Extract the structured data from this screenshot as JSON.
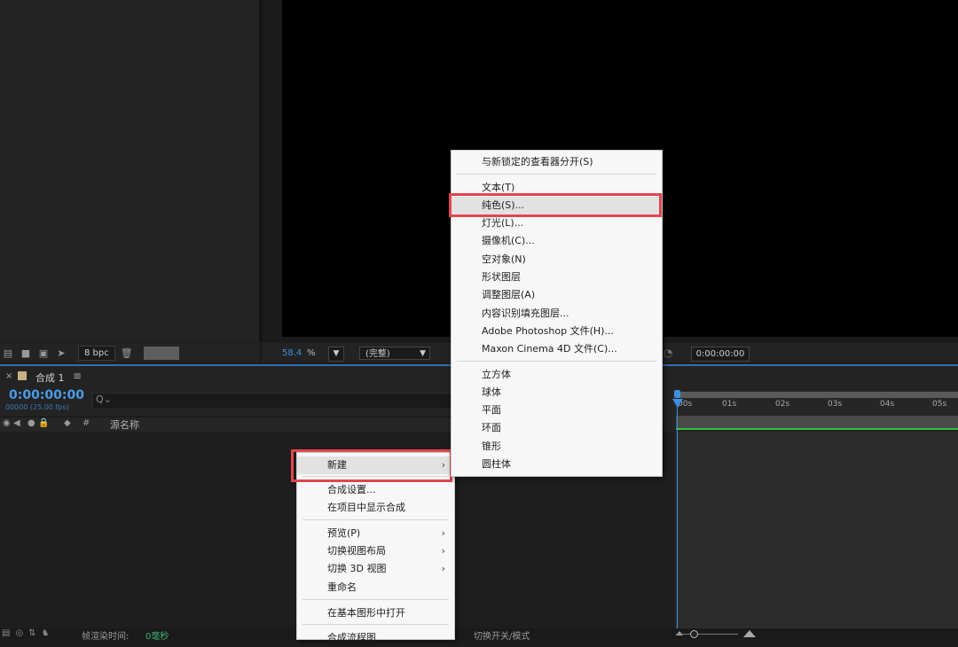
{
  "project_footer": {
    "bpc_label": "8 bpc"
  },
  "viewer_footer": {
    "zoom_value": "58.4",
    "zoom_unit": "%",
    "quality": "(完整)",
    "timecode": "0:00:00:00"
  },
  "timeline": {
    "tab_close": "×",
    "tab_title": "合成 1",
    "tab_menu": "≡",
    "timecode": "0:00:00:00",
    "fps": "00000 (25.00 fps)",
    "col_hash": "#",
    "col_source_name": "源名称",
    "ruler_ticks": [
      "00s",
      "01s",
      "02s",
      "03s",
      "04s",
      "05s"
    ]
  },
  "bottom_bar": {
    "render_label": "帧渲染时间:",
    "render_value": "0毫秒",
    "switch_label": "切换开关/模式"
  },
  "context_menu": {
    "items": [
      {
        "label": "新建",
        "submenu": true
      },
      {
        "label": "合成设置..."
      },
      {
        "label": "在项目中显示合成"
      },
      {
        "label": "预览(P)",
        "submenu": true
      },
      {
        "label": "切换视图布局",
        "submenu": true
      },
      {
        "label": "切换 3D 视图",
        "submenu": true
      },
      {
        "label": "重命名"
      },
      {
        "label": "在基本图形中打开"
      },
      {
        "label": "合成流程图"
      }
    ]
  },
  "submenu": {
    "items": [
      {
        "label": "与新锁定的查看器分开(S)"
      },
      {
        "label": "文本(T)"
      },
      {
        "label": "纯色(S)..."
      },
      {
        "label": "灯光(L)..."
      },
      {
        "label": "摄像机(C)..."
      },
      {
        "label": "空对象(N)"
      },
      {
        "label": "形状图层"
      },
      {
        "label": "调整图层(A)"
      },
      {
        "label": "内容识别填充图层..."
      },
      {
        "label": "Adobe Photoshop 文件(H)..."
      },
      {
        "label": "Maxon Cinema 4D 文件(C)..."
      },
      {
        "label": "立方体"
      },
      {
        "label": "球体"
      },
      {
        "label": "平面"
      },
      {
        "label": "环面"
      },
      {
        "label": "锥形"
      },
      {
        "label": "圆柱体"
      }
    ]
  },
  "colors": {
    "accent_blue": "#3d8fe0",
    "highlight_red": "#e0474c",
    "green_bar": "#2fbf3f"
  }
}
